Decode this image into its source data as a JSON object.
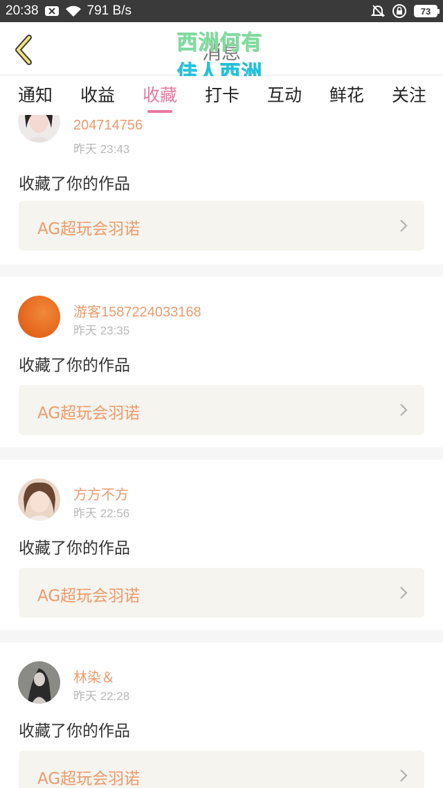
{
  "status_bar": {
    "time": "20:38",
    "net_speed": "791 B/s",
    "battery": "73",
    "icons": [
      "notification-x-icon",
      "wifi-icon",
      "mute-bell-icon",
      "lock-rotation-icon"
    ]
  },
  "header": {
    "title": "消息",
    "watermark_line1": "西洲何有",
    "watermark_line2": "佳人西洲",
    "back_icon": "chevron-left-icon",
    "accent_color": "#e9799f"
  },
  "tabs": [
    {
      "label": "通知",
      "active": false
    },
    {
      "label": "收益",
      "active": false
    },
    {
      "label": "收藏",
      "active": true
    },
    {
      "label": "打卡",
      "active": false
    },
    {
      "label": "互动",
      "active": false
    },
    {
      "label": "鲜花",
      "active": false
    },
    {
      "label": "关注",
      "active": false
    }
  ],
  "items": [
    {
      "username": "204714756",
      "time": "昨天 23:43",
      "action": "收藏了你的作品",
      "work": "AG超玩会羽诺"
    },
    {
      "username": "游客1587224033168",
      "time": "昨天 23:35",
      "action": "收藏了你的作品",
      "work": "AG超玩会羽诺"
    },
    {
      "username": "方方不方",
      "time": "昨天 22:56",
      "action": "收藏了你的作品",
      "work": "AG超玩会羽诺"
    },
    {
      "username": "林染＆",
      "time": "昨天 22:28",
      "action": "收藏了你的作品",
      "work": "AG超玩会羽诺"
    }
  ]
}
